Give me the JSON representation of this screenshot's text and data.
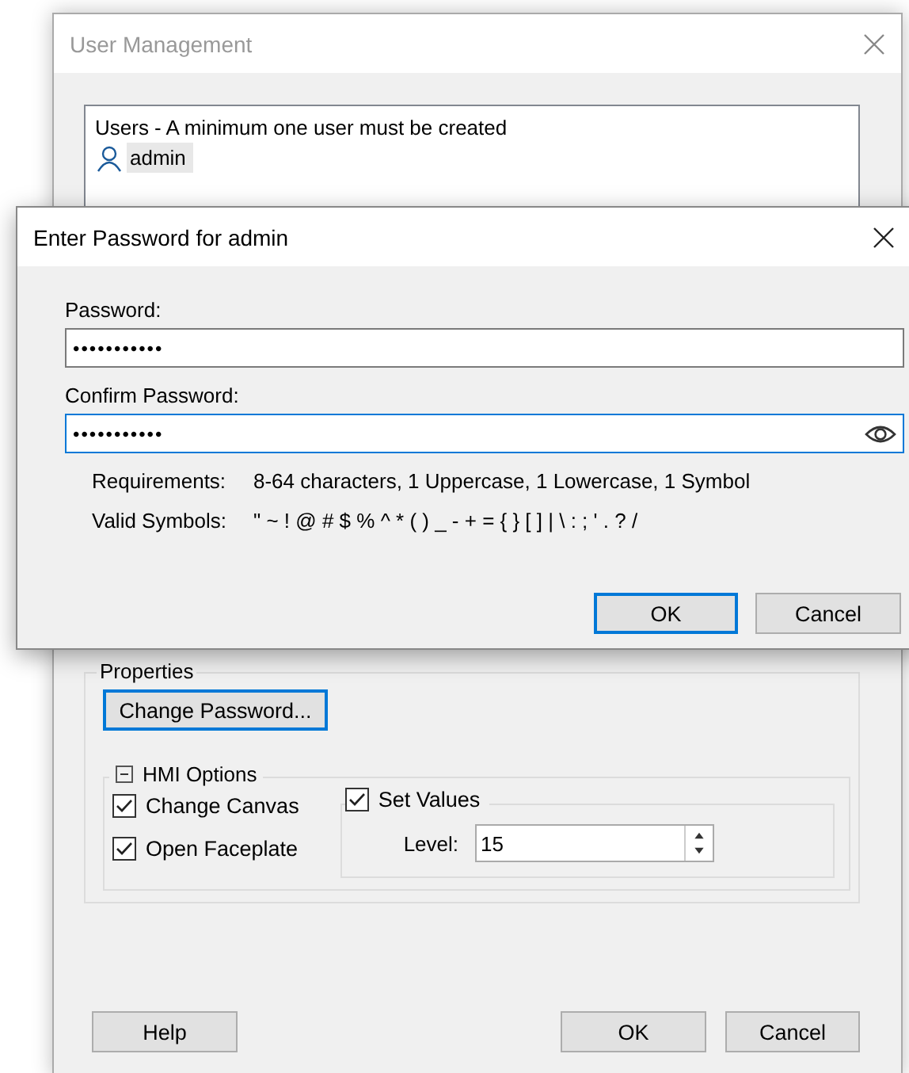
{
  "window": {
    "title": "User Management"
  },
  "users": {
    "heading": "Users - A minimum one user must be created",
    "items": [
      {
        "name": "admin",
        "selected": true
      }
    ]
  },
  "properties": {
    "title": "Properties",
    "change_password": "Change Password...",
    "hmi_options": {
      "title": "HMI Options",
      "expanded": true,
      "options": [
        {
          "label": "Change Canvas",
          "checked": true
        },
        {
          "label": "Open Faceplate",
          "checked": true
        }
      ],
      "set_values": {
        "label": "Set Values",
        "checked": true,
        "level_label": "Level:",
        "level_value": "15"
      }
    }
  },
  "buttons": {
    "help": "Help",
    "ok": "OK",
    "cancel": "Cancel"
  },
  "password_dialog": {
    "title": "Enter Password for admin",
    "password_label": "Password:",
    "password_value": "•••••••••••",
    "confirm_label": "Confirm Password:",
    "confirm_value": "•••••••••••",
    "requirements_label": "Requirements:",
    "requirements": "8-64 characters, 1 Uppercase, 1 Lowercase, 1 Symbol",
    "symbols_label": "Valid Symbols:",
    "symbols": "\" ~ ! @ # $ % ^ * ( ) _ - + = { } [ ] | \\ : ; ' . ? /",
    "ok": "OK",
    "cancel": "Cancel"
  }
}
